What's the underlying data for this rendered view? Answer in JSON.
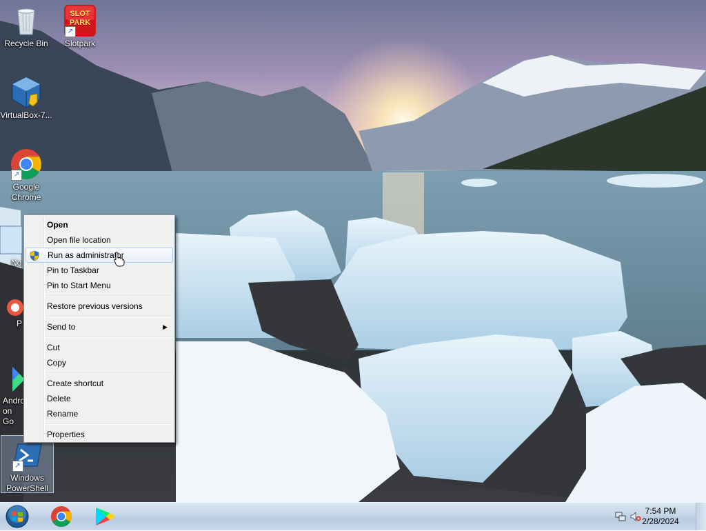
{
  "desktop": {
    "icons": [
      {
        "label": "Recycle Bin",
        "icon": "recycle-bin-icon"
      },
      {
        "label": "Slotpark",
        "icon": "slotpark-icon",
        "badge": "SLOT PARK"
      },
      {
        "label": "VirtualBox-7...",
        "icon": "virtualbox-icon"
      },
      {
        "label": "Google Chrome",
        "icon": "chrome-icon"
      },
      {
        "label": "No",
        "icon": "notepad-icon"
      },
      {
        "label": "P",
        "icon": "app-icon"
      },
      {
        "label": "Andro on Go",
        "icon": "android-icon"
      },
      {
        "label": "Windows PowerShell",
        "icon": "powershell-icon"
      }
    ]
  },
  "context_menu": {
    "items": [
      {
        "label": "Open",
        "bold": true
      },
      {
        "label": "Open file location"
      },
      {
        "label": "Run as administrator",
        "icon": "uac-shield-icon",
        "highlighted": true
      },
      {
        "label": "Pin to Taskbar"
      },
      {
        "label": "Pin to Start Menu"
      },
      {
        "label": "Restore previous versions"
      },
      {
        "label": "Send to",
        "submenu": true
      },
      {
        "label": "Cut"
      },
      {
        "label": "Copy"
      },
      {
        "label": "Create shortcut"
      },
      {
        "label": "Delete"
      },
      {
        "label": "Rename"
      },
      {
        "label": "Properties"
      }
    ]
  },
  "taskbar": {
    "start": "windows-start-orb-icon",
    "pinned": [
      "chrome-icon",
      "google-play-icon"
    ],
    "tray": [
      "network-icon",
      "volume-muted-icon"
    ],
    "time": "7:54 PM",
    "date": "2/28/2024"
  },
  "colors": {
    "menu_bg": "#f0f0f0",
    "menu_hover_border": "#aecff7",
    "taskbar_top": "#dbe7f2",
    "taskbar_bottom": "#c7d8ea"
  }
}
